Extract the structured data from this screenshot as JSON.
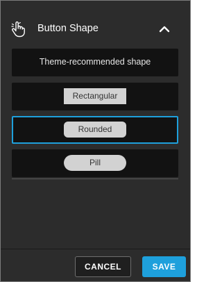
{
  "section": {
    "title": "Button Shape",
    "header_icon": "pointing-hand-icon",
    "toggle_icon": "chevron-up-icon"
  },
  "options": [
    {
      "label": "Theme-recommended shape",
      "selected": false
    },
    {
      "label": "Rectangular",
      "shape": "rectangular",
      "selected": false
    },
    {
      "label": "Rounded",
      "shape": "rounded",
      "selected": true
    },
    {
      "label": "Pill",
      "shape": "pill",
      "selected": false
    }
  ],
  "footer": {
    "cancel_label": "CANCEL",
    "save_label": "SAVE"
  },
  "colors": {
    "accent": "#1ea0dc",
    "panel_bg": "#2c2c2c",
    "option_bg": "#121212",
    "sample_bg": "#d2d2d2"
  }
}
